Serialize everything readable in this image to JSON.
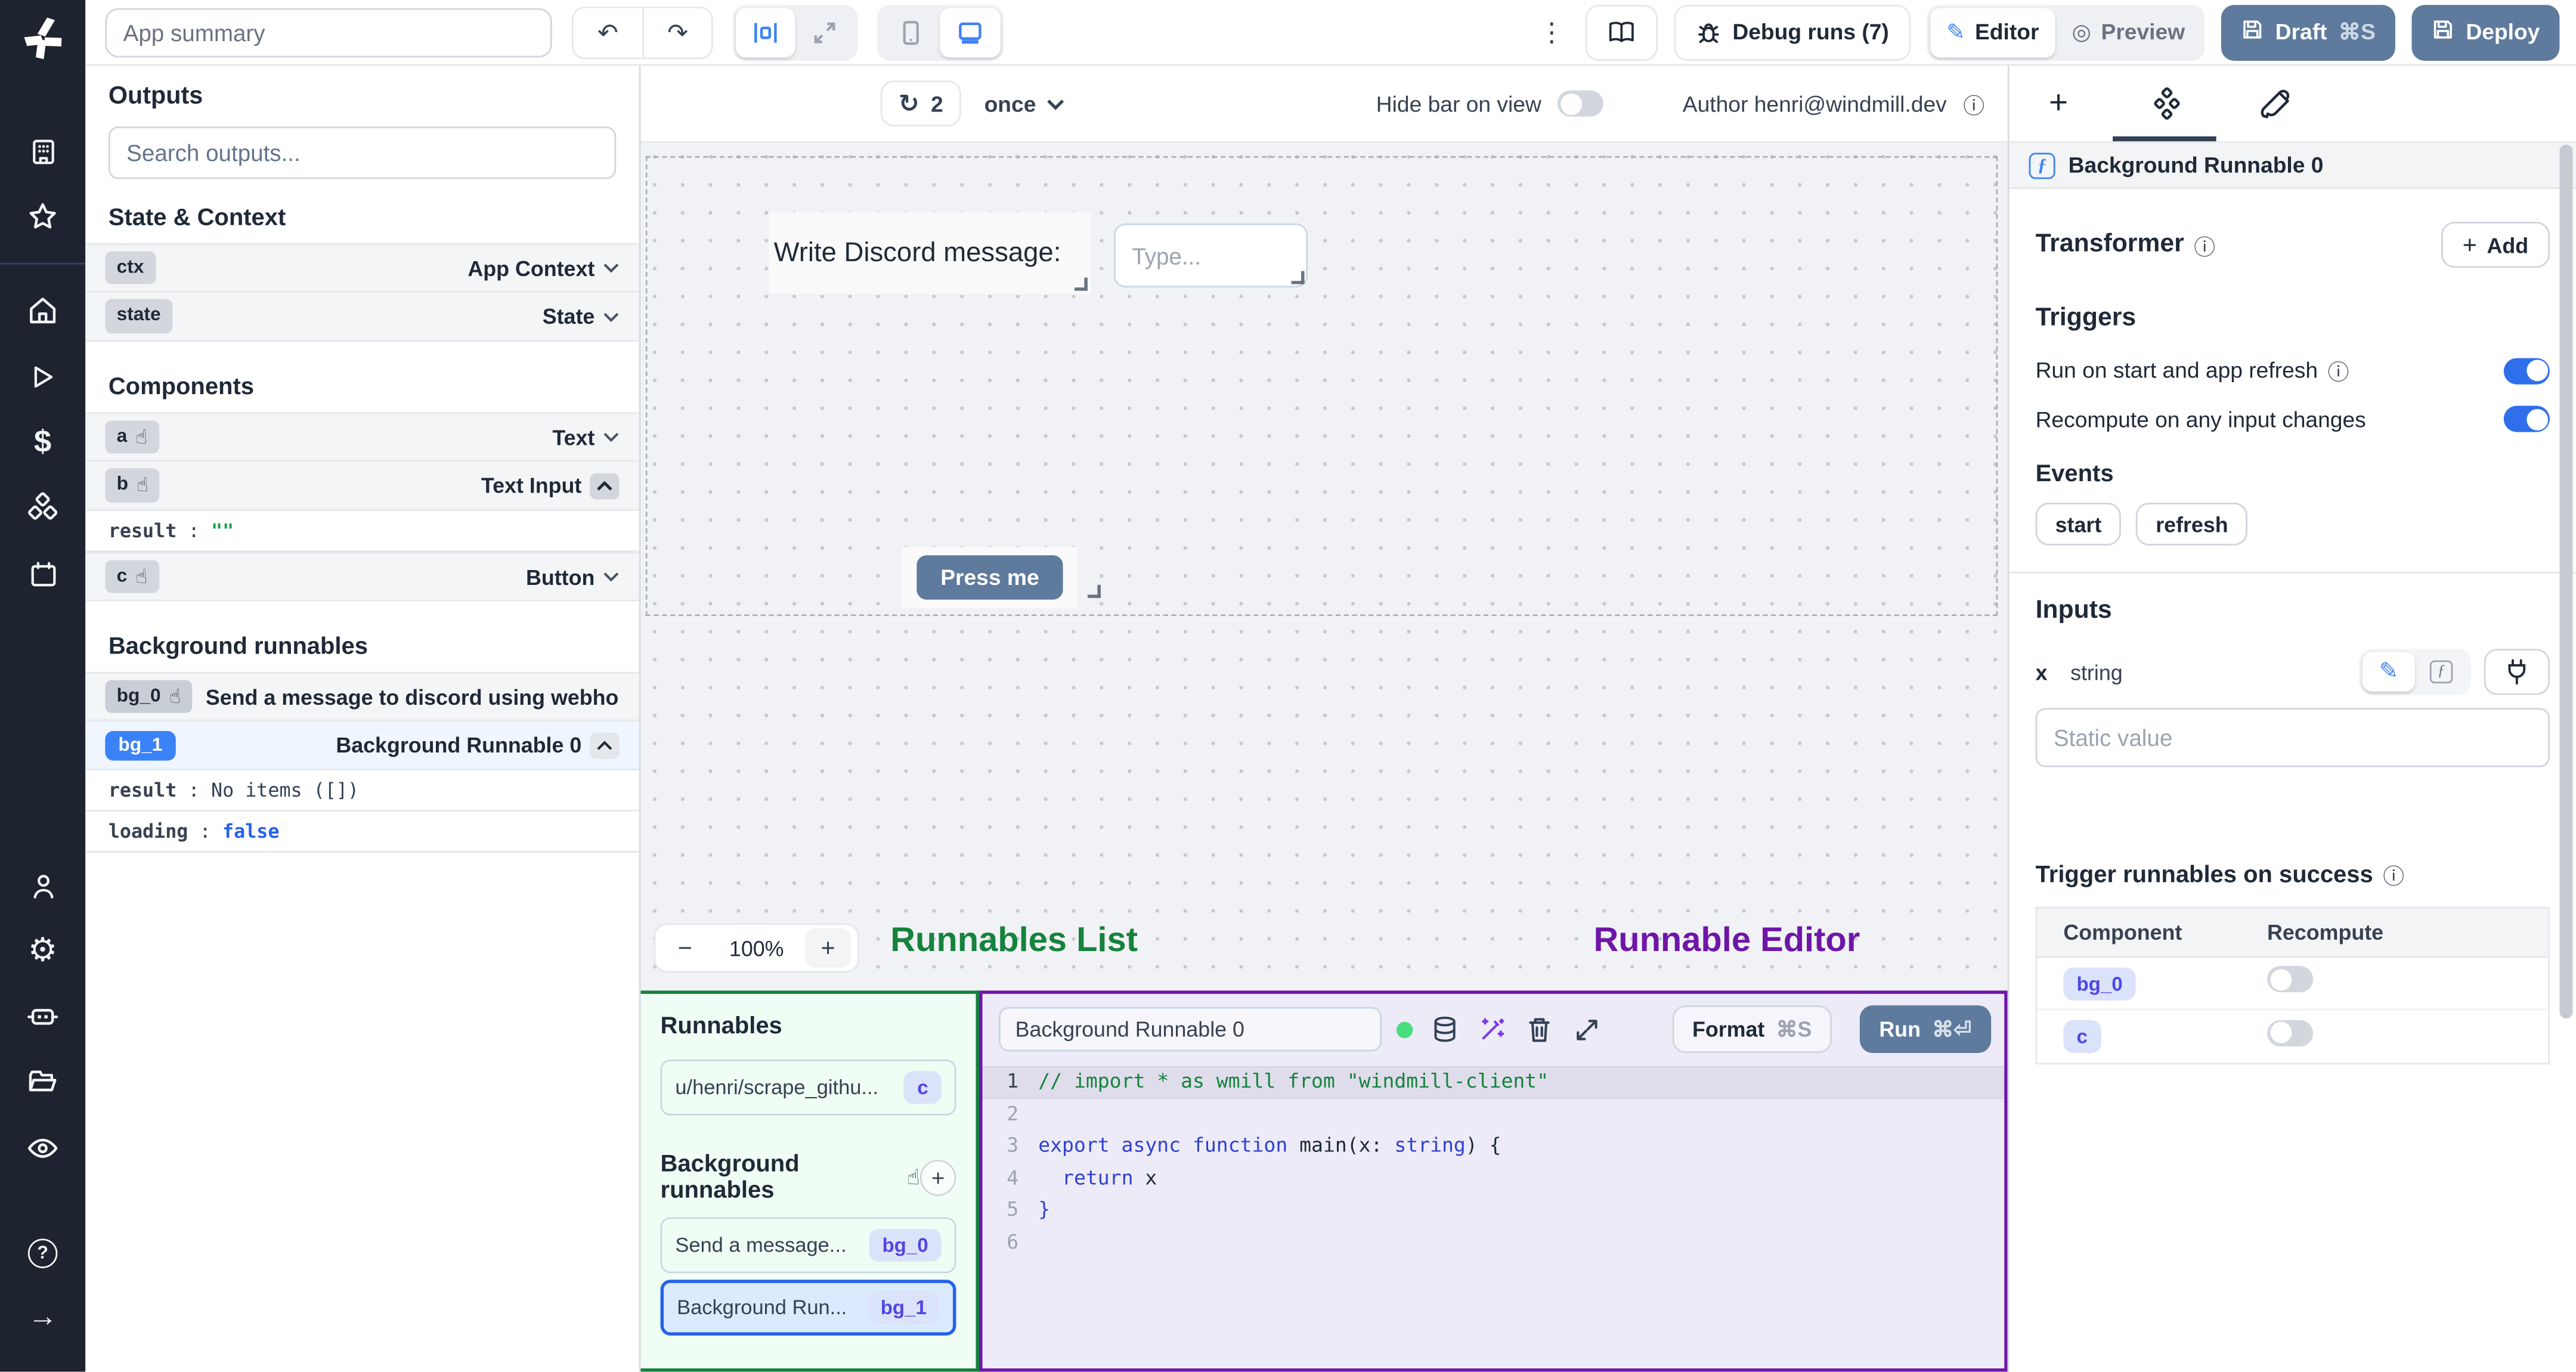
{
  "topbar": {
    "app_summary_placeholder": "App summary",
    "debug_runs_label": "Debug runs (7)",
    "editor_label": "Editor",
    "preview_label": "Preview",
    "draft_label": "Draft",
    "draft_shortcut": "⌘S",
    "deploy_label": "Deploy"
  },
  "canvas_bar": {
    "refresh_count": "2",
    "frequency": "once",
    "hide_bar_label": "Hide bar on view",
    "author_label": "Author henri@windmill.dev",
    "info_icon": "ⓘ"
  },
  "outputs": {
    "title": "Outputs",
    "search_placeholder": "Search outputs...",
    "state_context_title": "State & Context",
    "context_rows": [
      {
        "key": "ctx",
        "type": "App Context"
      },
      {
        "key": "state",
        "type": "State"
      }
    ],
    "components_title": "Components",
    "component_rows": [
      {
        "key": "a",
        "type": "Text"
      },
      {
        "key": "b",
        "type": "Text Input"
      },
      {
        "key": "c",
        "type": "Button"
      }
    ],
    "b_detail": {
      "key": "result",
      "sep": ":",
      "value": "\"\""
    },
    "background_title": "Background runnables",
    "bg_rows": [
      {
        "key": "bg_0",
        "label": "Send a message to discord using webhoo"
      },
      {
        "key": "bg_1",
        "label": "Background Runnable 0"
      }
    ],
    "bg1_detail": {
      "result_key": "result",
      "sep": ":",
      "result_value": "No items ([])",
      "loading_key": "loading",
      "loading_value": "false"
    }
  },
  "canvas": {
    "text_component": "Write Discord message:",
    "input_placeholder": "Type...",
    "button_label": "Press me",
    "zoom_minus": "−",
    "zoom_level": "100%",
    "zoom_plus": "+",
    "runnables_list_label": "Runnables List",
    "runnable_editor_label": "Runnable Editor"
  },
  "runnables_panel": {
    "title": "Runnables",
    "item_script": {
      "label": "u/henri/scrape_githu...",
      "badge": "c"
    },
    "background_title": "Background runnables",
    "item_bg0": {
      "label": "Send a message...",
      "badge": "bg_0"
    },
    "item_bg1": {
      "label": "Background Run...",
      "badge": "bg_1"
    },
    "add_label": "+"
  },
  "editor": {
    "name": "Background Runnable 0",
    "format_label": "Format",
    "format_shortcut": "⌘S",
    "run_label": "Run",
    "run_shortcut": "⌘⏎",
    "line_numbers": [
      "1",
      "2",
      "3",
      "4",
      "5",
      "6"
    ],
    "code": {
      "l1_comment": "// import * as wmill from \"windmill-client\"",
      "l3_kw": "export async function ",
      "l3_mid": "main(x: ",
      "l3_type": "string",
      "l3_end": ") {",
      "l4_indent": "  ",
      "l4_kw": "return",
      "l4_rest": " x",
      "l5": "}"
    }
  },
  "right_panel": {
    "header": "Background Runnable 0",
    "transformer_label": "Transformer",
    "add_label": "Add",
    "triggers_title": "Triggers",
    "run_on_start_label": "Run on start and app refresh",
    "recompute_label": "Recompute on any input changes",
    "events_title": "Events",
    "event_start": "start",
    "event_refresh": "refresh",
    "inputs_title": "Inputs",
    "input_name": "x",
    "input_type": "string",
    "static_value_placeholder": "Static value",
    "trigger_success_title": "Trigger runnables on success",
    "table": {
      "header_component": "Component",
      "header_recompute": "Recompute",
      "rows": [
        {
          "component": "bg_0"
        },
        {
          "component": "c"
        }
      ]
    },
    "info_icon": "ⓘ"
  },
  "colors": {
    "accent_blue": "#3b82f6",
    "toggle_on_blue": "#2f6feb",
    "slate_button": "#5e7a9d",
    "runnables_green": "#15803d",
    "editor_purple": "#6e16a8",
    "code_comment_green": "#15833c",
    "code_keyword_blue": "#2f3fd3",
    "badge_indigo_text": "#4f46e5",
    "result_green": "#16a34a",
    "loading_blue": "#2563eb",
    "rail_background": "#1e2330"
  }
}
